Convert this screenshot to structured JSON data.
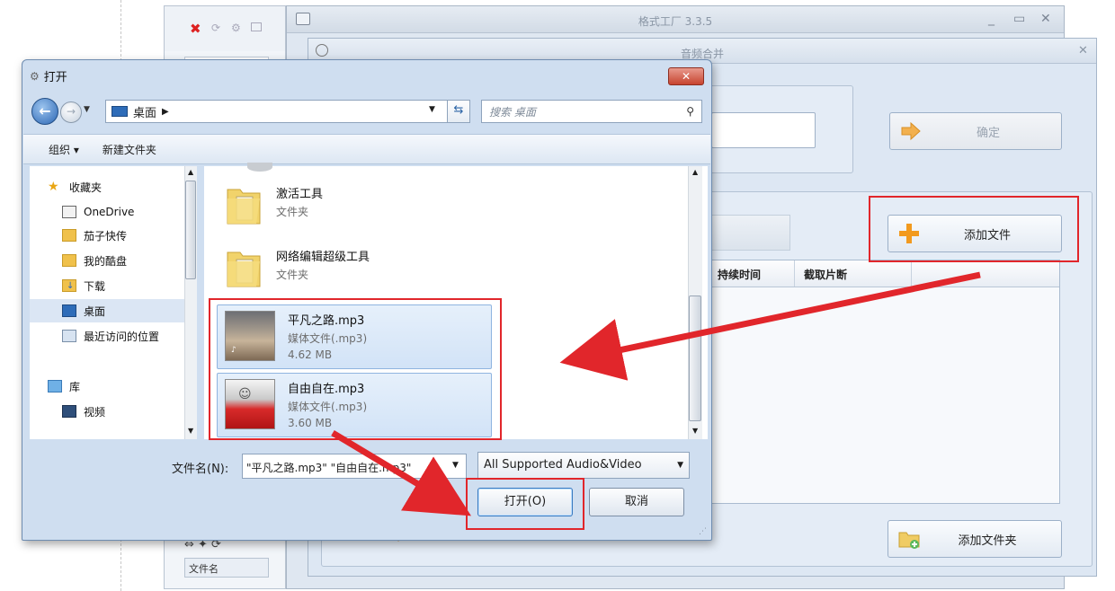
{
  "main_window": {
    "title": "格式工厂 3.3.5",
    "controls": [
      "_",
      "▭",
      "✕"
    ],
    "left_column_header": "文件名"
  },
  "merge_window": {
    "title": "音频合并",
    "close": "✕",
    "ok_button": "确定",
    "add_file_button": "添加文件",
    "add_folder_button": "添加文件夹",
    "list_headers": [
      "持续时间",
      "截取片断"
    ]
  },
  "open_dialog": {
    "title": "打开",
    "close": "✕",
    "breadcrumb": "桌面",
    "search_placeholder": "搜索 桌面",
    "toolbar": {
      "organize": "组织 ▾",
      "new_folder": "新建文件夹"
    },
    "nav_items": [
      {
        "label": "收藏夹",
        "icon": "star-icon"
      },
      {
        "label": "OneDrive",
        "icon": "onedrive-icon"
      },
      {
        "label": "茄子快传",
        "icon": "folder-icon"
      },
      {
        "label": "我的酷盘",
        "icon": "folder-icon"
      },
      {
        "label": "下载",
        "icon": "download-folder-icon"
      },
      {
        "label": "桌面",
        "icon": "desktop-icon",
        "selected": true
      },
      {
        "label": "最近访问的位置",
        "icon": "recent-places-icon"
      },
      {
        "label": "库",
        "icon": "library-icon"
      },
      {
        "label": "视频",
        "icon": "video-icon"
      }
    ],
    "files": [
      {
        "name": "激活工具",
        "type": "文件夹",
        "size": "",
        "kind": "folder"
      },
      {
        "name": "网络编辑超级工具",
        "type": "文件夹",
        "size": "",
        "kind": "folder"
      },
      {
        "name": "平凡之路.mp3",
        "type": "媒体文件(.mp3)",
        "size": "4.62 MB",
        "kind": "audio"
      },
      {
        "name": "自由自在.mp3",
        "type": "媒体文件(.mp3)",
        "size": "3.60 MB",
        "kind": "audio"
      }
    ],
    "filename_label": "文件名(N):",
    "filename_value": "\"平凡之路.mp3\" \"自由自在.mp3\"",
    "filetype_value": "All Supported Audio&Video",
    "open_button": "打开(O)",
    "cancel_button": "取消"
  },
  "colors": {
    "highlight_red": "#e1262b",
    "selection_blue": "#d2e3f7",
    "window_bg": "#dde7f3"
  }
}
